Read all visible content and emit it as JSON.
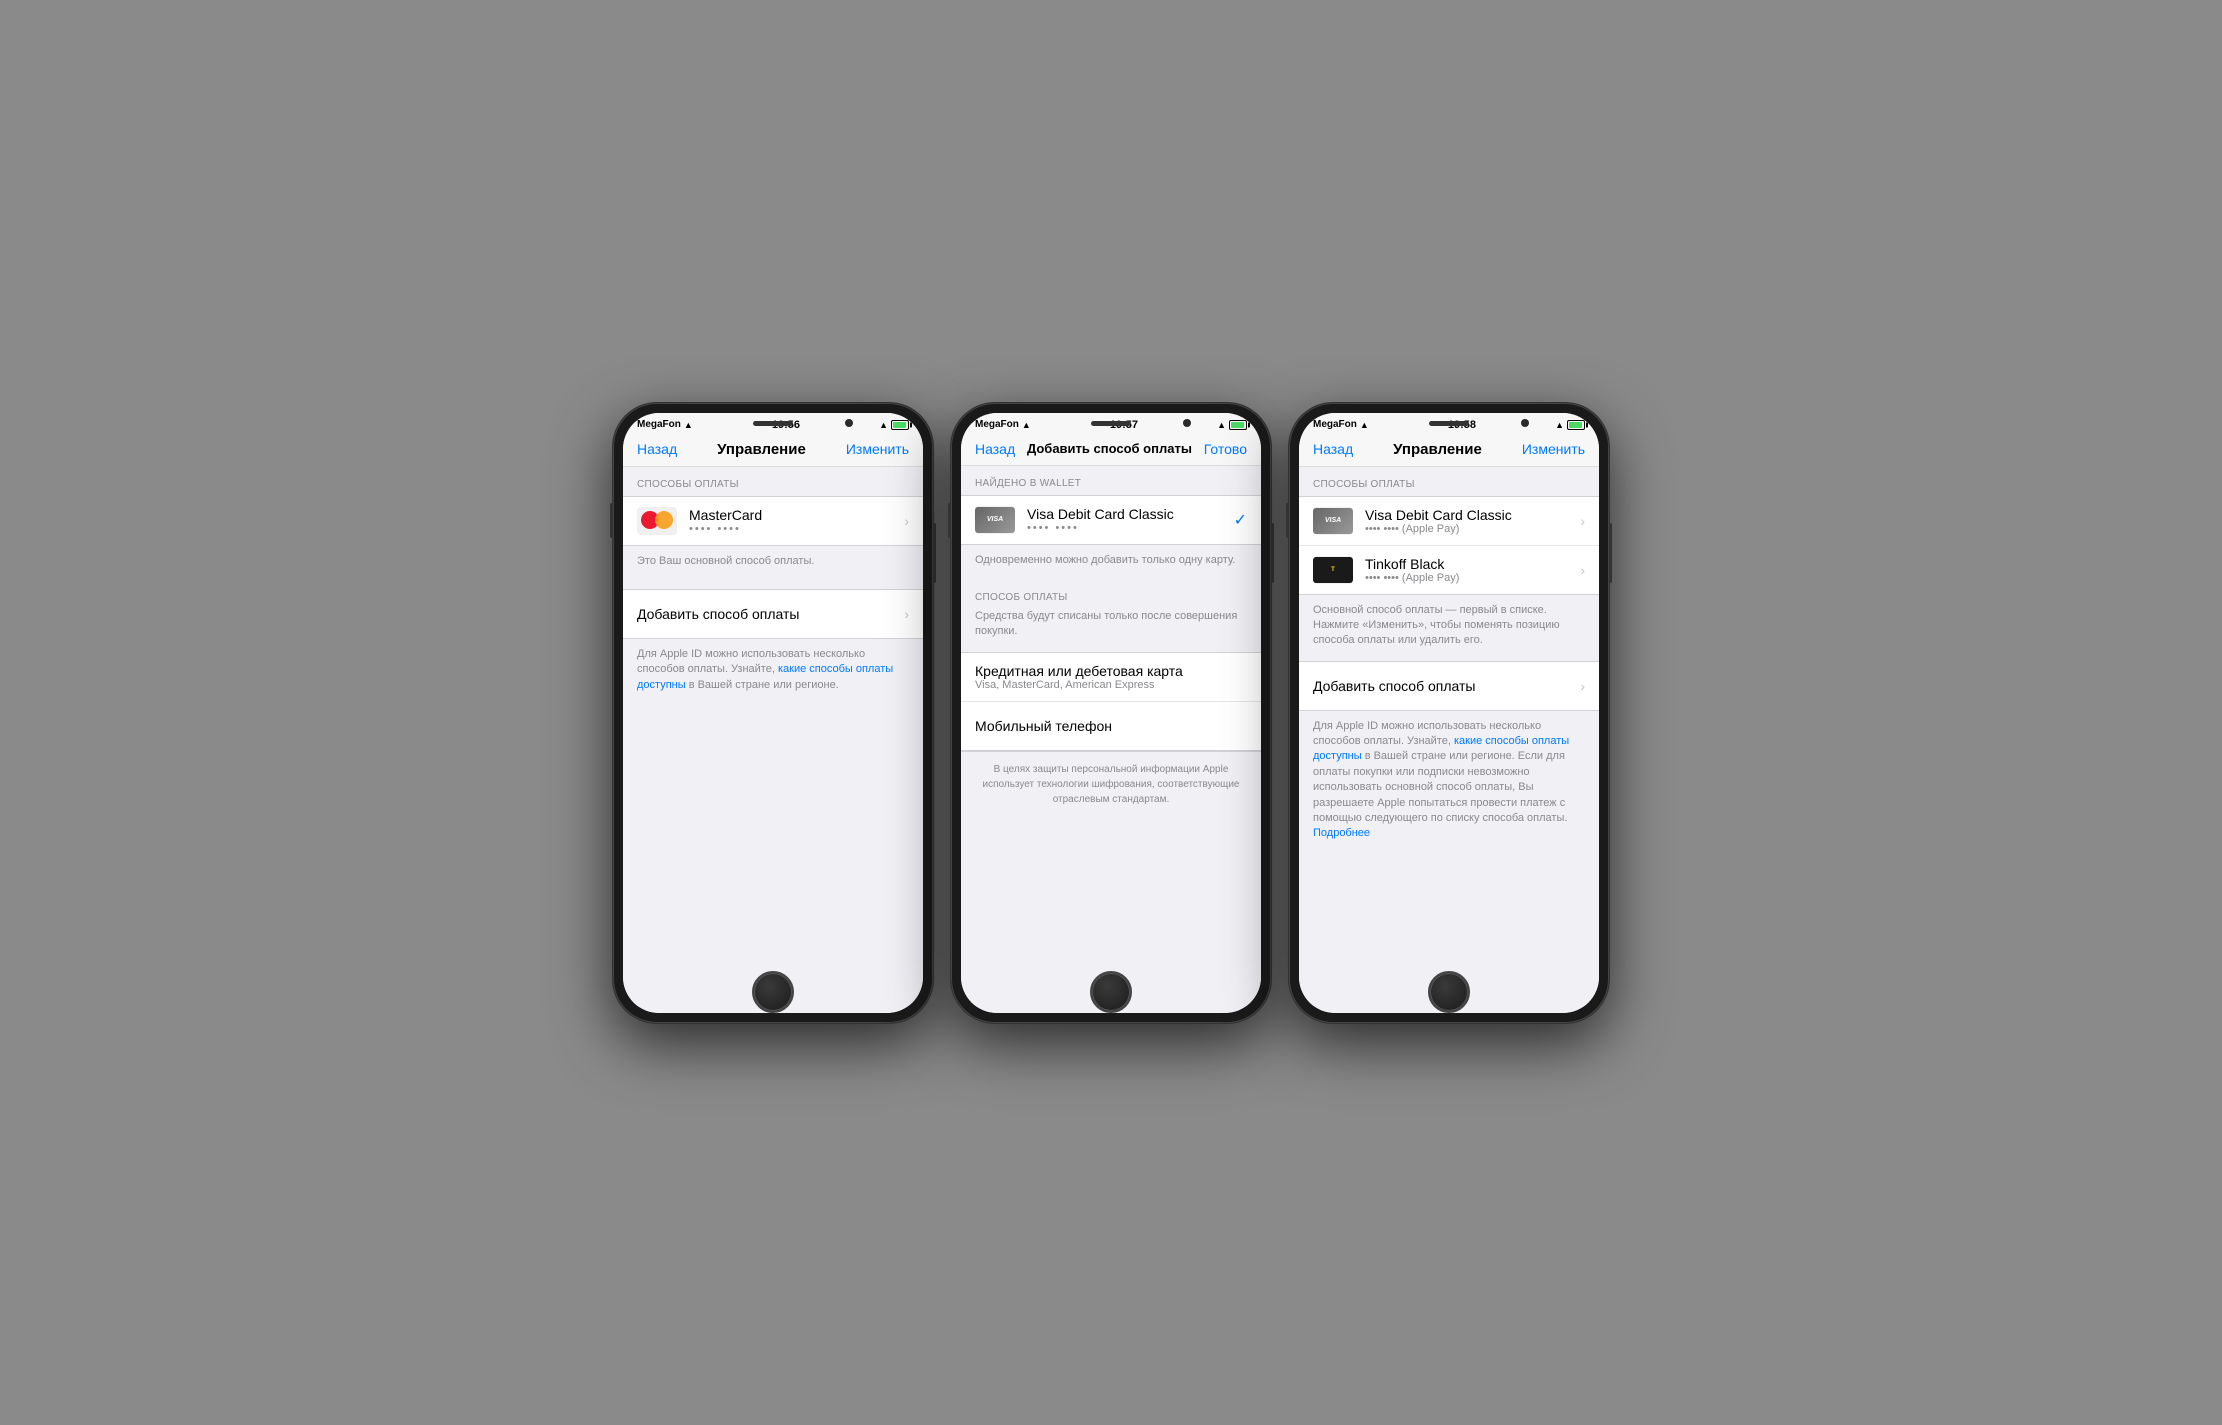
{
  "phone1": {
    "status": {
      "carrier": "MegaFon",
      "time": "19:56",
      "battery_pct": "80"
    },
    "navbar": {
      "back": "Назад",
      "title": "Управление",
      "action": "Изменить"
    },
    "section1_header": "СПОСОБЫ ОПЛАТЫ",
    "card": {
      "name": "MasterCard",
      "mask": "•••• ••••"
    },
    "primary_label": "Это Ваш основной способ оплаты.",
    "add_payment": "Добавить способ оплаты",
    "footer_text": "Для Apple ID можно использовать несколько способов оплаты. Узнайте, ",
    "footer_link": "какие способы оплаты доступны",
    "footer_text2": " в Вашей стране или регионе."
  },
  "phone2": {
    "status": {
      "carrier": "MegaFon",
      "time": "19:57",
      "battery_pct": "80"
    },
    "navbar": {
      "back": "Назад",
      "title": "Добавить способ оплаты",
      "action": "Готово"
    },
    "section_wallet_header": "НАЙДЕНО В WALLET",
    "wallet_card": {
      "name": "Visa Debit Card Classic",
      "mask": "•••• ••••"
    },
    "wallet_note": "Одновременно можно добавить только одну карту.",
    "section_payment_header": "СПОСОБ ОПЛАТЫ",
    "payment_note": "Средства будут списаны только после совершения покупки.",
    "credit_card_title": "Кредитная или дебетовая карта",
    "credit_card_subtitle": "Visa, MasterCard, American Express",
    "mobile_phone": "Мобильный телефон",
    "footer_security": "В целях защиты персональной информации Apple использует технологии шифрования, соответствующие отраслевым стандартам."
  },
  "phone3": {
    "status": {
      "carrier": "MegaFon",
      "time": "19:58",
      "battery_pct": "80"
    },
    "navbar": {
      "back": "Назад",
      "title": "Управление",
      "action": "Изменить"
    },
    "section1_header": "СПОСОБЫ ОПЛАТЫ",
    "card1": {
      "name": "Visa Debit Card Classic",
      "mask": "•••• •••• (Apple Pay)"
    },
    "card2": {
      "name": "Tinkoff Black",
      "mask": "•••• •••• (Apple Pay)"
    },
    "info_text": "Основной способ оплаты — первый в списке. Нажмите «Изменить», чтобы поменять позицию способа оплаты или удалить его.",
    "add_payment": "Добавить способ оплаты",
    "footer_text": "Для Apple ID можно использовать несколько способов оплаты. Узнайте, ",
    "footer_link": "какие способы оплаты доступны",
    "footer_text2": " в Вашей стране или регионе. Если для оплаты покупки или подписки невозможно использовать основной способ оплаты, Вы разрешаете Apple попытаться провести платеж с помощью следующего по списку способа оплаты.",
    "more_link": "Подробнее"
  }
}
